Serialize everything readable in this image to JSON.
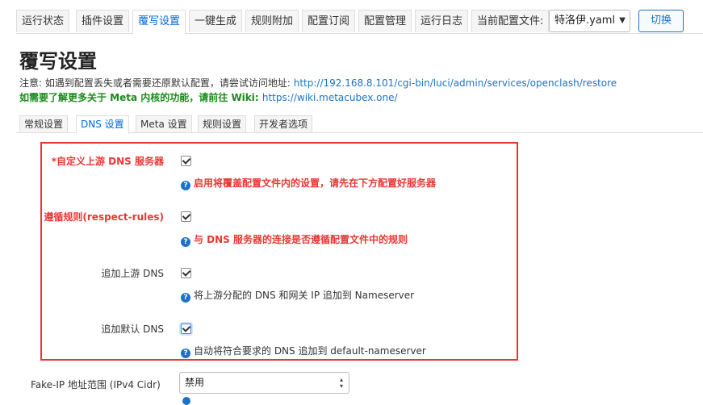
{
  "top_tabs": [
    "运行状态",
    "插件设置",
    "覆写设置",
    "一键生成",
    "规则附加",
    "配置订阅",
    "配置管理",
    "运行日志"
  ],
  "current_config_label": "当前配置文件:",
  "current_config_value": "特洛伊.yaml",
  "switch_button": "切换",
  "page_title": "覆写设置",
  "note_prefix": "注意: 如遇到配置丢失或者需要还原默认配置，请尝试访问地址: ",
  "note_link": "http://192.168.8.101/cgi-bin/luci/admin/services/openclash/restore",
  "wiki_prefix": "如需要了解更多关于 Meta 内核的功能，请前往 Wiki: ",
  "wiki_link": "https://wiki.metacubex.one/",
  "sub_tabs": [
    "常规设置",
    "DNS 设置",
    "Meta 设置",
    "规则设置",
    "开发者选项"
  ],
  "options": [
    {
      "label": "*自定义上游 DNS 服务器",
      "help": "启用将覆盖配置文件内的设置，请先在下方配置好服务器",
      "checked": true
    },
    {
      "label": "遵循规则(respect-rules)",
      "help": "与 DNS 服务器的连接是否遵循配置文件中的规则",
      "checked": true
    },
    {
      "label": "追加上游 DNS",
      "help": "将上游分配的 DNS 和网关 IP 追加到 Nameserver",
      "checked": true
    },
    {
      "label": "追加默认 DNS",
      "help": "自动将符合要求的 DNS 追加到 default-nameserver",
      "checked": true
    }
  ],
  "fakeip_label": "Fake-IP 地址范围 (IPv4 Cidr)",
  "fakeip_value": "禁用",
  "colors": {
    "accent": "#1d72c8",
    "highlight_red": "#e53935",
    "green": "#1a8a1a"
  }
}
